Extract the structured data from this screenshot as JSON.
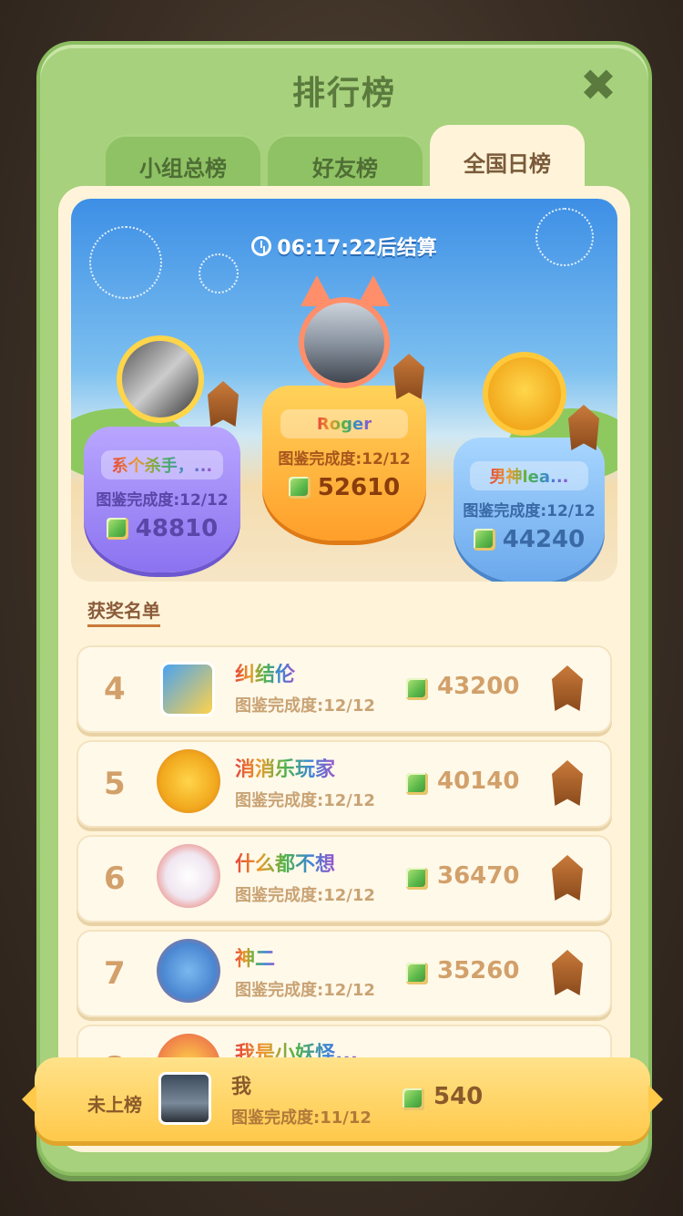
{
  "panel": {
    "title": "排行榜",
    "close_icon": "close-icon"
  },
  "tabs": [
    {
      "label": "小组总榜",
      "active": false
    },
    {
      "label": "好友榜",
      "active": false
    },
    {
      "label": "全国日榜",
      "active": true
    }
  ],
  "timer": {
    "text": "06:17:22后结算",
    "icon": "clock-icon"
  },
  "podium": [
    {
      "rank": 2,
      "name": "系个杀手，...",
      "progress": "图鉴完成度:12/12",
      "score": "48810",
      "color": "#8b73f0"
    },
    {
      "rank": 1,
      "name": "Roger",
      "progress": "图鉴完成度:12/12",
      "score": "52610",
      "color": "#ff9f2a"
    },
    {
      "rank": 3,
      "name": "男神lea...",
      "progress": "图鉴完成度:12/12",
      "score": "44240",
      "color": "#6aa8ec"
    }
  ],
  "section_label": "获奖名单",
  "rank_list": [
    {
      "rank": "4",
      "name": "纠结伦",
      "progress": "图鉴完成度:12/12",
      "score": "43200"
    },
    {
      "rank": "5",
      "name": "消消乐玩家",
      "progress": "图鉴完成度:12/12",
      "score": "40140"
    },
    {
      "rank": "6",
      "name": "什么都不想",
      "progress": "图鉴完成度:12/12",
      "score": "36470"
    },
    {
      "rank": "7",
      "name": "神二",
      "progress": "图鉴完成度:12/12",
      "score": "35260"
    },
    {
      "rank": "8",
      "name": "我是小妖怪...",
      "progress": "",
      "score": ""
    }
  ],
  "my_entry": {
    "rank_text": "未上榜",
    "name": "我",
    "progress": "图鉴完成度:11/12",
    "score": "540"
  },
  "colors": {
    "panel_green": "#a7d17c",
    "content_cream": "#fff4d9",
    "rank_text": "#d2a06a"
  }
}
